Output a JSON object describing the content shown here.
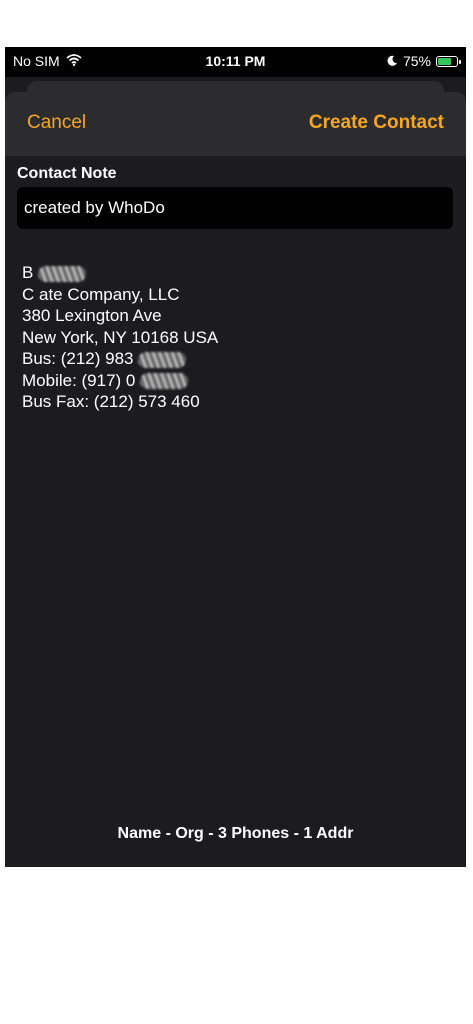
{
  "status_bar": {
    "carrier": "No SIM",
    "time": "10:11 PM",
    "battery": "75%",
    "battery_level": 0.75
  },
  "nav": {
    "cancel_label": "Cancel",
    "create_label": "Create Contact"
  },
  "note": {
    "label": "Contact Note",
    "value": "created by WhoDo"
  },
  "contact_lines": [
    "B",
    "C ate Company, LLC",
    "380 Lexington Ave",
    "New York, NY 10168 USA",
    "Bus: (212) 983",
    "Mobile: (917) 0",
    "Bus Fax: (212) 573 460"
  ],
  "summary": "Name - Org - 3 Phones - 1 Addr",
  "colors": {
    "accent": "#f5a623",
    "background": "#1c1c1e",
    "nav_background": "#2c2c2e"
  }
}
